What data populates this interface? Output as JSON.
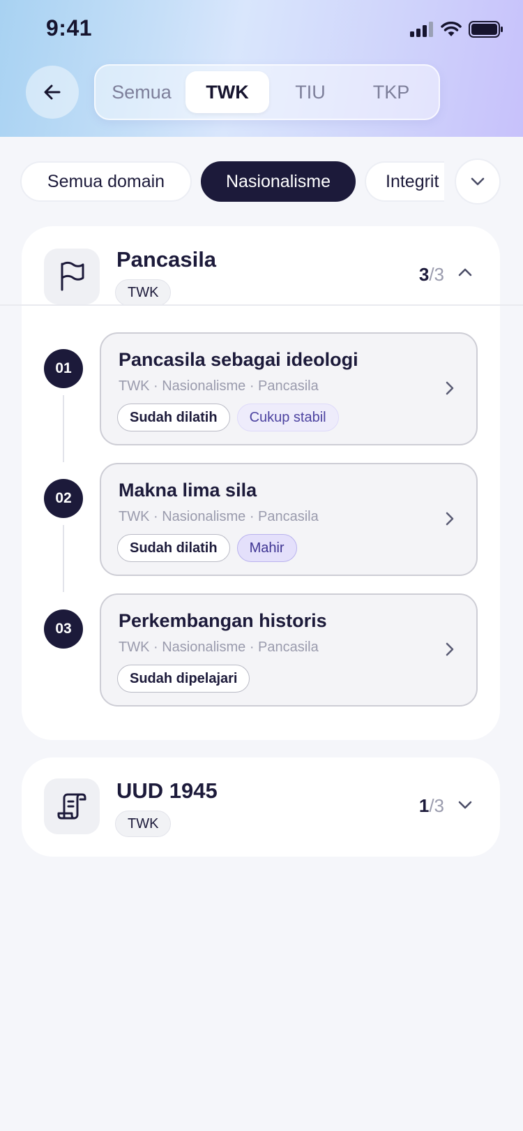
{
  "status_bar": {
    "time": "9:41"
  },
  "header": {
    "back_icon": "arrow-left-icon",
    "tabs": [
      {
        "label": "Semua",
        "active": false
      },
      {
        "label": "TWK",
        "active": true
      },
      {
        "label": "TIU",
        "active": false
      },
      {
        "label": "TKP",
        "active": false
      }
    ]
  },
  "filters": {
    "chips": [
      {
        "label": "Semua domain",
        "active": false
      },
      {
        "label": "Nasionalisme",
        "active": true
      },
      {
        "label": "Integrit",
        "active": false
      }
    ],
    "dropdown_icon": "chevron-down-icon"
  },
  "topics": [
    {
      "title": "Pancasila",
      "tag": "TWK",
      "icon": "flag-icon",
      "count_done": "3",
      "count_total": "/3",
      "expanded": true,
      "lessons": [
        {
          "number": "01",
          "title": "Pancasila sebagai ideologi",
          "subtitle": "TWK · Nasionalisme · Pancasila",
          "badges": [
            "Sudah dilatih",
            "Cukup stabil"
          ]
        },
        {
          "number": "02",
          "title": "Makna lima sila",
          "subtitle": "TWK · Nasionalisme · Pancasila",
          "badges": [
            "Sudah dilatih",
            "Mahir"
          ]
        },
        {
          "number": "03",
          "title": "Perkembangan historis",
          "subtitle": "TWK · Nasionalisme · Pancasila",
          "badges": [
            "Sudah dipelajari"
          ]
        }
      ]
    },
    {
      "title": "UUD 1945",
      "tag": "TWK",
      "icon": "scroll-icon",
      "count_done": "1",
      "count_total": "/3",
      "expanded": false
    }
  ]
}
